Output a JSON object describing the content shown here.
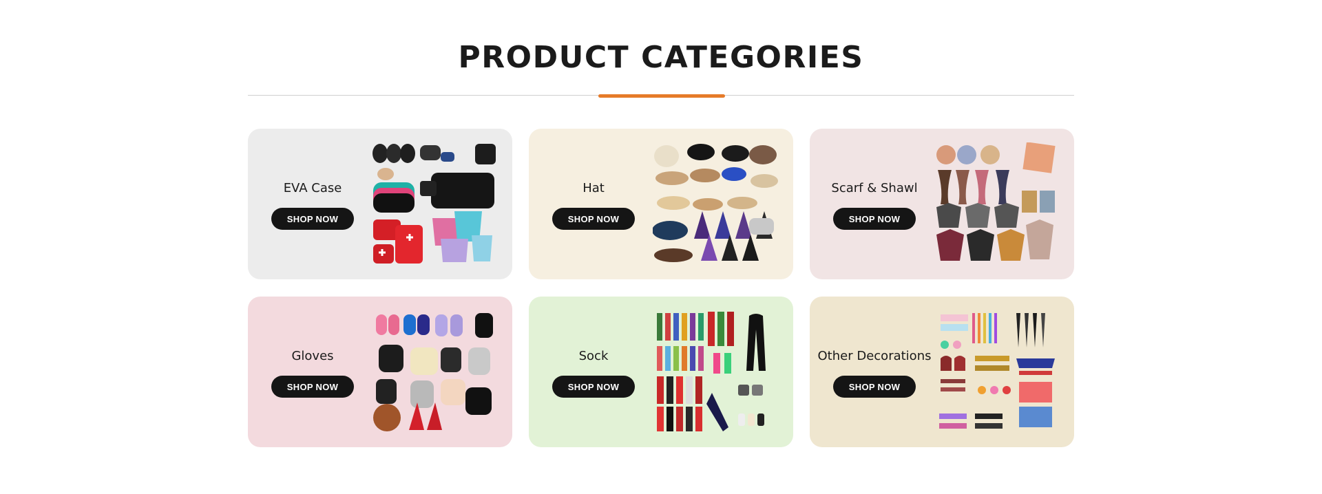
{
  "header": {
    "title": "PRODUCT CATEGORIES",
    "accent_color": "#e67b29"
  },
  "categories": [
    {
      "name": "EVA Case",
      "button": "SHOP NOW",
      "bg": "#ececec",
      "icon": "eva-case-products-image"
    },
    {
      "name": "Hat",
      "button": "SHOP NOW",
      "bg": "#f6efe0",
      "icon": "hat-products-image"
    },
    {
      "name": "Scarf & Shawl",
      "button": "SHOP NOW",
      "bg": "#f1e4e4",
      "icon": "scarf-shawl-products-image"
    },
    {
      "name": "Gloves",
      "button": "SHOP NOW",
      "bg": "#f3dade",
      "icon": "gloves-products-image"
    },
    {
      "name": "Sock",
      "button": "SHOP NOW",
      "bg": "#e2f2d6",
      "icon": "sock-products-image"
    },
    {
      "name": "Other Decorations",
      "button": "SHOP NOW",
      "bg": "#efe6cf",
      "icon": "decorations-products-image"
    }
  ]
}
